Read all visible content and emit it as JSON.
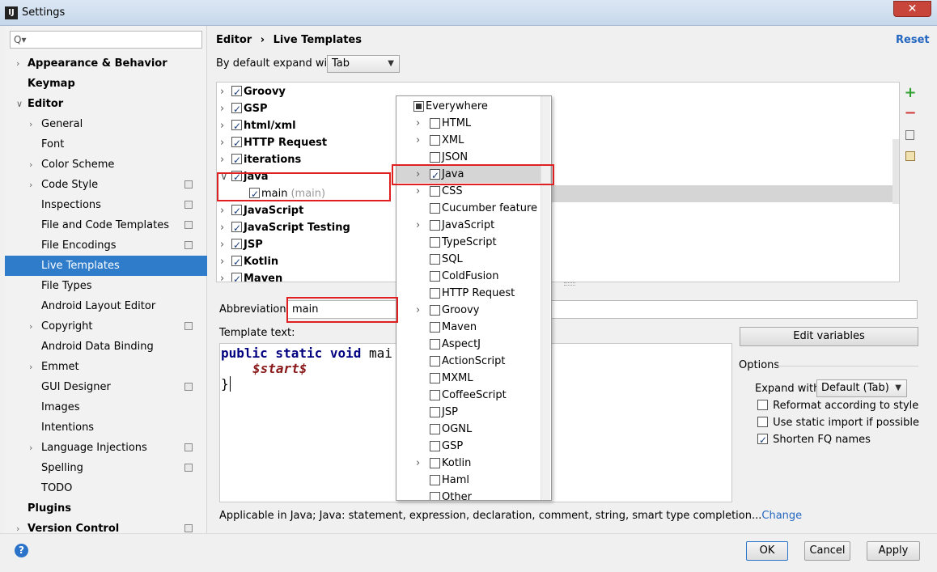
{
  "window": {
    "title": "Settings",
    "close_label": "✕"
  },
  "search": {
    "placeholder": "Q▾"
  },
  "sidebar": {
    "items": [
      {
        "label": "Appearance & Behavior",
        "bold": true,
        "chevron": true,
        "indent": 0
      },
      {
        "label": "Keymap",
        "bold": true,
        "chevron": false,
        "indent": 0
      },
      {
        "label": "Editor",
        "bold": true,
        "chevron": true,
        "open": true,
        "indent": 0
      },
      {
        "label": "General",
        "chevron": true,
        "indent": 1
      },
      {
        "label": "Font",
        "chevron": false,
        "indent": 1
      },
      {
        "label": "Color Scheme",
        "chevron": true,
        "indent": 1
      },
      {
        "label": "Code Style",
        "chevron": true,
        "gear": true,
        "indent": 1
      },
      {
        "label": "Inspections",
        "chevron": false,
        "gear": true,
        "indent": 1
      },
      {
        "label": "File and Code Templates",
        "chevron": false,
        "gear": true,
        "indent": 1
      },
      {
        "label": "File Encodings",
        "chevron": false,
        "gear": true,
        "indent": 1
      },
      {
        "label": "Live Templates",
        "chevron": false,
        "selected": true,
        "indent": 1
      },
      {
        "label": "File Types",
        "chevron": false,
        "indent": 1
      },
      {
        "label": "Android Layout Editor",
        "chevron": false,
        "indent": 1
      },
      {
        "label": "Copyright",
        "chevron": true,
        "gear": true,
        "indent": 1
      },
      {
        "label": "Android Data Binding",
        "chevron": false,
        "indent": 1
      },
      {
        "label": "Emmet",
        "chevron": true,
        "indent": 1
      },
      {
        "label": "GUI Designer",
        "chevron": false,
        "gear": true,
        "indent": 1
      },
      {
        "label": "Images",
        "chevron": false,
        "indent": 1
      },
      {
        "label": "Intentions",
        "chevron": false,
        "indent": 1
      },
      {
        "label": "Language Injections",
        "chevron": true,
        "gear": true,
        "indent": 1
      },
      {
        "label": "Spelling",
        "chevron": false,
        "gear": true,
        "indent": 1
      },
      {
        "label": "TODO",
        "chevron": false,
        "indent": 1
      },
      {
        "label": "Plugins",
        "bold": true,
        "chevron": false,
        "indent": 0
      },
      {
        "label": "Version Control",
        "bold": true,
        "chevron": true,
        "gear": true,
        "indent": 0
      }
    ]
  },
  "header": {
    "crumb_editor": "Editor",
    "crumb_sep": "›",
    "crumb_page": "Live Templates",
    "reset": "Reset"
  },
  "expand_default": {
    "label": "By default expand with",
    "value": "Tab"
  },
  "template_groups": [
    {
      "label": "Groovy",
      "checked": true
    },
    {
      "label": "GSP",
      "checked": true
    },
    {
      "label": "html/xml",
      "checked": true
    },
    {
      "label": "HTTP Request",
      "checked": true
    },
    {
      "label": "iterations",
      "checked": true
    },
    {
      "label": "java",
      "checked": true,
      "open": true
    },
    {
      "label": "main",
      "suffix": "(main)",
      "checked": true,
      "child": true
    },
    {
      "label": "JavaScript",
      "checked": true
    },
    {
      "label": "JavaScript Testing",
      "checked": true
    },
    {
      "label": "JSP",
      "checked": true
    },
    {
      "label": "Kotlin",
      "checked": true
    },
    {
      "label": "Maven",
      "checked": true
    }
  ],
  "contexts": [
    {
      "label": "Everywhere",
      "checked": false,
      "partial": true,
      "chevron": false,
      "indent": 0
    },
    {
      "label": "HTML",
      "chevron": true
    },
    {
      "label": "XML",
      "chevron": true
    },
    {
      "label": "JSON",
      "chevron": false
    },
    {
      "label": "Java",
      "chevron": true,
      "checked": true,
      "selected": true
    },
    {
      "label": "CSS",
      "chevron": true
    },
    {
      "label": "Cucumber feature",
      "chevron": false
    },
    {
      "label": "JavaScript",
      "chevron": true
    },
    {
      "label": "TypeScript",
      "chevron": false
    },
    {
      "label": "SQL",
      "chevron": false
    },
    {
      "label": "ColdFusion",
      "chevron": false
    },
    {
      "label": "HTTP Request",
      "chevron": false
    },
    {
      "label": "Groovy",
      "chevron": true
    },
    {
      "label": "Maven",
      "chevron": false
    },
    {
      "label": "AspectJ",
      "chevron": false
    },
    {
      "label": "ActionScript",
      "chevron": false
    },
    {
      "label": "MXML",
      "chevron": false
    },
    {
      "label": "CoffeeScript",
      "chevron": false
    },
    {
      "label": "JSP",
      "chevron": false
    },
    {
      "label": "OGNL",
      "chevron": false
    },
    {
      "label": "GSP",
      "chevron": false
    },
    {
      "label": "Kotlin",
      "chevron": true
    },
    {
      "label": "Haml",
      "chevron": false
    },
    {
      "label": "Other",
      "chevron": false
    }
  ],
  "abbreviation": {
    "label": "Abbreviation:",
    "value": "main"
  },
  "template_text": {
    "label": "Template text:",
    "line1_kw": "public static void",
    "line1_rest": " mai",
    "line2_var": "$start$",
    "line3": "}"
  },
  "edit_variables": "Edit variables",
  "options": {
    "title": "Options",
    "expand_with_label": "Expand with",
    "expand_with_value": "Default (Tab)",
    "reformat": {
      "label": "Reformat according to style",
      "checked": false
    },
    "static_import": {
      "label": "Use static import if possible",
      "checked": false
    },
    "shorten_fq": {
      "label": "Shorten FQ names",
      "checked": true
    }
  },
  "applicable": {
    "text": "Applicable in Java; Java: statement, expression, declaration, comment, string, smart type completion...",
    "change": "Change"
  },
  "buttons": {
    "ok": "OK",
    "cancel": "Cancel",
    "apply": "Apply",
    "help": "?"
  },
  "toolbar": {
    "add": "+",
    "remove": "−"
  }
}
